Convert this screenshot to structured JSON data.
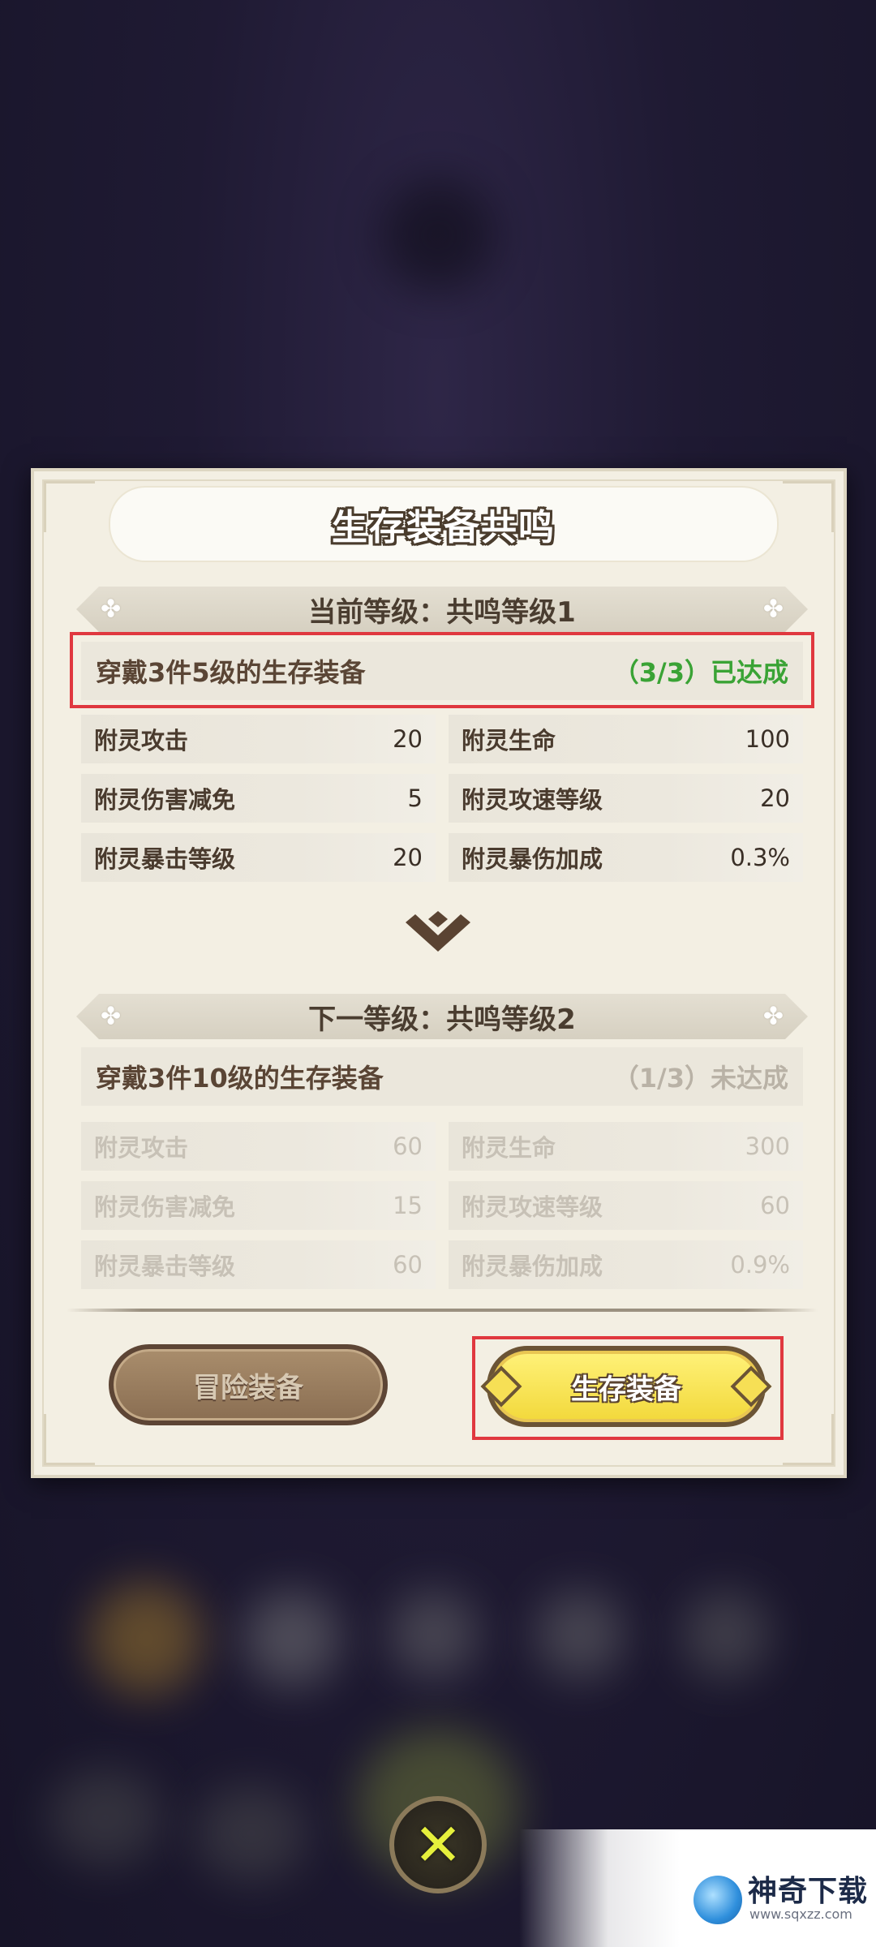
{
  "dialog": {
    "title": "生存装备共鸣",
    "current": {
      "header": "当前等级：共鸣等级1",
      "requirement": "穿戴3件5级的生存装备",
      "progress": "（3/3）已达成",
      "stats": [
        {
          "name": "附灵攻击",
          "value": "20"
        },
        {
          "name": "附灵生命",
          "value": "100"
        },
        {
          "name": "附灵伤害减免",
          "value": "5"
        },
        {
          "name": "附灵攻速等级",
          "value": "20"
        },
        {
          "name": "附灵暴击等级",
          "value": "20"
        },
        {
          "name": "附灵暴伤加成",
          "value": "0.3%"
        }
      ]
    },
    "next": {
      "header": "下一等级：共鸣等级2",
      "requirement": "穿戴3件10级的生存装备",
      "progress": "（1/3）未达成",
      "stats": [
        {
          "name": "附灵攻击",
          "value": "60"
        },
        {
          "name": "附灵生命",
          "value": "300"
        },
        {
          "name": "附灵伤害减免",
          "value": "15"
        },
        {
          "name": "附灵攻速等级",
          "value": "60"
        },
        {
          "name": "附灵暴击等级",
          "value": "60"
        },
        {
          "name": "附灵暴伤加成",
          "value": "0.9%"
        }
      ]
    },
    "buttons": {
      "adventure": "冒险装备",
      "survival": "生存装备"
    }
  },
  "watermark": {
    "brand": "神奇下载",
    "url": "www.sqxzz.com"
  },
  "colors": {
    "achieved": "#3aa335",
    "not_achieved": "#b9b2a6",
    "highlight": "#e0383f",
    "primary_button": "#f6df55"
  }
}
